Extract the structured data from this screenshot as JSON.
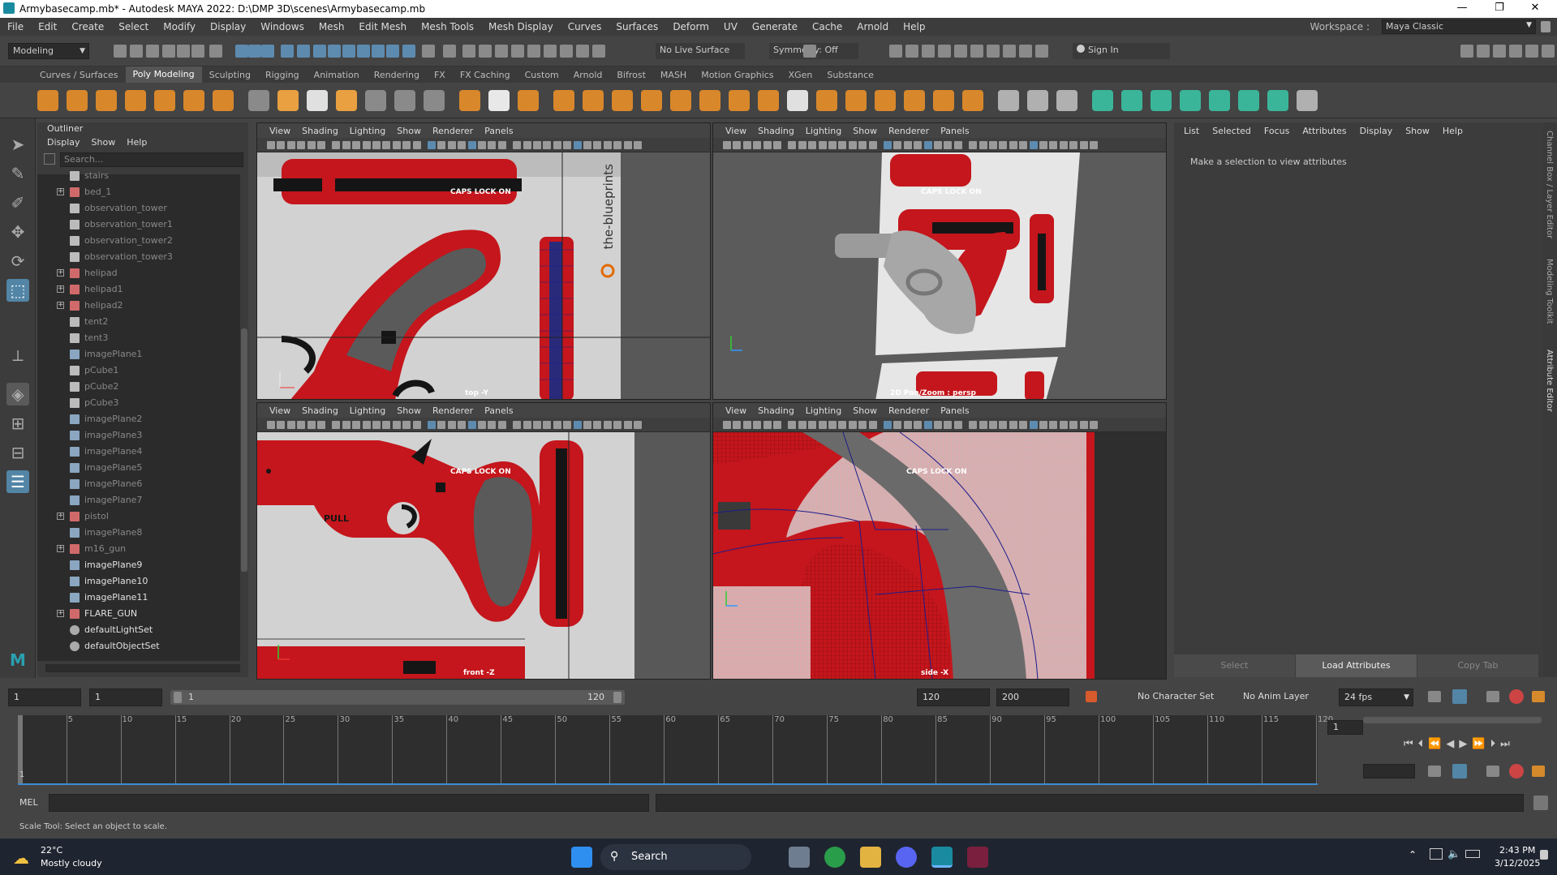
{
  "window": {
    "title": "Armybasecamp.mb* - Autodesk MAYA 2022: D:\\DMP 3D\\scenes\\Armybasecamp.mb",
    "minimize": "—",
    "maximize": "❐",
    "close": "✕"
  },
  "menus": [
    "File",
    "Edit",
    "Create",
    "Select",
    "Modify",
    "Display",
    "Windows",
    "Mesh",
    "Edit Mesh",
    "Mesh Tools",
    "Mesh Display",
    "Curves",
    "Surfaces",
    "Deform",
    "UV",
    "Generate",
    "Cache",
    "Arnold",
    "Help"
  ],
  "workspace": {
    "label": "Workspace :",
    "value": "Maya Classic"
  },
  "statusline": {
    "mode": "Modeling",
    "live_surface": "No Live Surface",
    "symmetry": "Symmetry: Off",
    "sign_in": "Sign In"
  },
  "shelf_tabs": [
    "Curves / Surfaces",
    "Poly Modeling",
    "Sculpting",
    "Rigging",
    "Animation",
    "Rendering",
    "FX",
    "FX Caching",
    "Custom",
    "Arnold",
    "Bifrost",
    "MASH",
    "Motion Graphics",
    "XGen",
    "Substance"
  ],
  "shelf_active": "Poly Modeling",
  "outliner": {
    "title": "Outliner",
    "menu": [
      "Display",
      "Show",
      "Help"
    ],
    "search_placeholder": "Search...",
    "items": [
      {
        "label": "stairs",
        "exp": false,
        "type": "obj",
        "dim": true
      },
      {
        "label": "bed_1",
        "exp": true,
        "type": "grp",
        "dim": true
      },
      {
        "label": "observation_tower",
        "exp": false,
        "type": "obj",
        "dim": true
      },
      {
        "label": "observation_tower1",
        "exp": false,
        "type": "obj",
        "dim": true
      },
      {
        "label": "observation_tower2",
        "exp": false,
        "type": "obj",
        "dim": true
      },
      {
        "label": "observation_tower3",
        "exp": false,
        "type": "obj",
        "dim": true
      },
      {
        "label": "helipad",
        "exp": true,
        "type": "grp",
        "dim": true
      },
      {
        "label": "helipad1",
        "exp": true,
        "type": "grp",
        "dim": true
      },
      {
        "label": "helipad2",
        "exp": true,
        "type": "grp",
        "dim": true
      },
      {
        "label": "tent2",
        "exp": false,
        "type": "obj",
        "dim": true
      },
      {
        "label": "tent3",
        "exp": false,
        "type": "obj",
        "dim": true
      },
      {
        "label": "imagePlane1",
        "exp": false,
        "type": "img",
        "dim": true
      },
      {
        "label": "pCube1",
        "exp": false,
        "type": "obj",
        "dim": true
      },
      {
        "label": "pCube2",
        "exp": false,
        "type": "obj",
        "dim": true
      },
      {
        "label": "pCube3",
        "exp": false,
        "type": "obj",
        "dim": true
      },
      {
        "label": "imagePlane2",
        "exp": false,
        "type": "img",
        "dim": true
      },
      {
        "label": "imagePlane3",
        "exp": false,
        "type": "img",
        "dim": true
      },
      {
        "label": "imagePlane4",
        "exp": false,
        "type": "img",
        "dim": true
      },
      {
        "label": "imagePlane5",
        "exp": false,
        "type": "img",
        "dim": true
      },
      {
        "label": "imagePlane6",
        "exp": false,
        "type": "img",
        "dim": true
      },
      {
        "label": "imagePlane7",
        "exp": false,
        "type": "img",
        "dim": true
      },
      {
        "label": "pistol",
        "exp": true,
        "type": "grp",
        "dim": true
      },
      {
        "label": "imagePlane8",
        "exp": false,
        "type": "img",
        "dim": true
      },
      {
        "label": "m16_gun",
        "exp": true,
        "type": "grp",
        "dim": true
      },
      {
        "label": "imagePlane9",
        "exp": false,
        "type": "img",
        "dim": false
      },
      {
        "label": "imagePlane10",
        "exp": false,
        "type": "img",
        "dim": false
      },
      {
        "label": "imagePlane11",
        "exp": false,
        "type": "img",
        "dim": false
      },
      {
        "label": "FLARE_GUN",
        "exp": true,
        "type": "grp",
        "dim": false
      },
      {
        "label": "defaultLightSet",
        "exp": false,
        "type": "set",
        "dim": false
      },
      {
        "label": "defaultObjectSet",
        "exp": false,
        "type": "set",
        "dim": false
      }
    ]
  },
  "viewports": {
    "menu": [
      "View",
      "Shading",
      "Lighting",
      "Show",
      "Renderer",
      "Panels"
    ],
    "top": {
      "camera": "top -Y",
      "caps": "CAPS LOCK ON",
      "watermark": "the-blueprints"
    },
    "persp": {
      "camera": "2D Pan/Zoom : persp",
      "caps": "CAPS LOCK ON"
    },
    "front": {
      "camera": "front -Z",
      "caps": "CAPS LOCK ON",
      "pull": "PULL"
    },
    "side": {
      "camera": "side -X",
      "caps": "CAPS LOCK ON"
    }
  },
  "attribute_editor": {
    "menu": [
      "List",
      "Selected",
      "Focus",
      "Attributes",
      "Display",
      "Show",
      "Help"
    ],
    "message": "Make a selection to view attributes",
    "buttons": [
      "Select",
      "Load Attributes",
      "Copy Tab"
    ]
  },
  "side_tabs": [
    "Channel Box / Layer Editor",
    "Modeling Toolkit",
    "Attribute Editor"
  ],
  "range": {
    "start": "1",
    "playback_start": "1",
    "slider_start": "1",
    "slider_end": "120",
    "playback_end": "120",
    "end": "200",
    "character_set": "No Character Set",
    "anim_layer": "No Anim Layer",
    "fps": "24 fps"
  },
  "timeline": {
    "ticks": [
      "5",
      "10",
      "15",
      "20",
      "25",
      "30",
      "35",
      "40",
      "45",
      "50",
      "55",
      "60",
      "65",
      "70",
      "75",
      "80",
      "85",
      "90",
      "95",
      "100",
      "105",
      "110",
      "115",
      "120"
    ],
    "current": "1",
    "frame_field": "1"
  },
  "mel": {
    "label": "MEL"
  },
  "help_line": "Scale Tool: Select an object to scale.",
  "taskbar": {
    "temp": "22°C",
    "weather": "Mostly cloudy",
    "search": "Search",
    "time": "2:43 PM",
    "date": "3/12/2025"
  },
  "colors": {
    "gun_red": "#c4161c",
    "maya_bg": "#444444",
    "panel_dark": "#2b2b2b"
  }
}
